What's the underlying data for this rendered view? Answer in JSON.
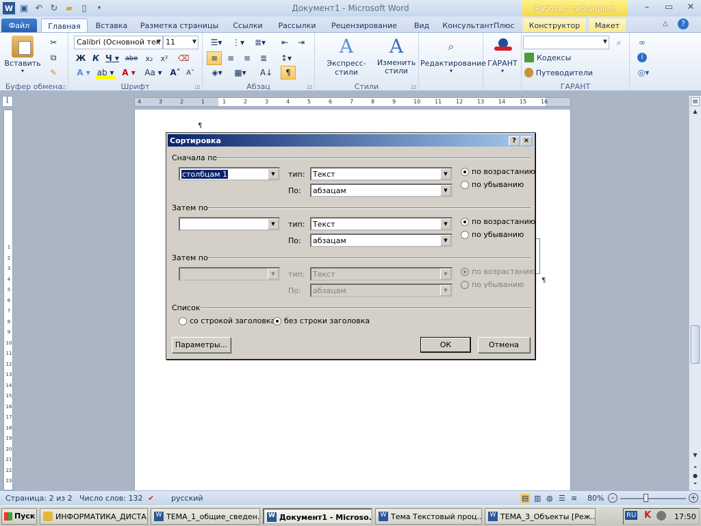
{
  "window": {
    "title": "Документ1 - Microsoft Word",
    "context_tab_header": "Работа с таблицами"
  },
  "tabs": [
    "Файл",
    "Главная",
    "Вставка",
    "Разметка страницы",
    "Ссылки",
    "Рассылки",
    "Рецензирование",
    "Вид",
    "КонсультантПлюс",
    "Конструктор",
    "Макет"
  ],
  "ribbon": {
    "clipboard": {
      "label": "Буфер обмена",
      "paste": "Вставить"
    },
    "font": {
      "label": "Шрифт",
      "font_name": "Calibri (Основной тек",
      "font_size": "11"
    },
    "paragraph": {
      "label": "Абзац"
    },
    "styles": {
      "label": "Стили",
      "express": "Экспресс-стили",
      "change": "Изменить стили"
    },
    "editing": {
      "label": "Редактирование"
    },
    "garant_btn": {
      "label": "ГАРАНТ"
    },
    "garant": {
      "label": "ГАРАНТ",
      "codecs": "Кодексы",
      "guides": "Путеводители"
    }
  },
  "ruler": {
    "h_ticks": [
      "4",
      "3",
      "2",
      "1",
      "1",
      "2",
      "3",
      "4",
      "5",
      "6",
      "7",
      "8",
      "9",
      "10",
      "11",
      "12",
      "13",
      "14",
      "15",
      "16"
    ],
    "v_ticks": [
      "1",
      "2",
      "3",
      "4",
      "5",
      "6",
      "7",
      "8",
      "9",
      "10",
      "11",
      "12",
      "13",
      "14",
      "15",
      "16",
      "17",
      "18",
      "19",
      "20",
      "21",
      "22",
      "23"
    ]
  },
  "document": {
    "pilcrow": "¶"
  },
  "dialog": {
    "title": "Сортировка",
    "help": "?",
    "close": "×",
    "first": {
      "heading": "Сначала по",
      "field": "столбцам 1",
      "type_label": "тип:",
      "type_value": "Текст",
      "by_label": "По:",
      "by_value": "абзацам",
      "asc": "по возрастанию",
      "desc": "по убыванию"
    },
    "second": {
      "heading": "Затем по",
      "field": "",
      "type_label": "тип:",
      "type_value": "Текст",
      "by_label": "По:",
      "by_value": "абзацам",
      "asc": "по возрастанию",
      "desc": "по убыванию"
    },
    "third": {
      "heading": "Затем по",
      "field": "",
      "type_label": "тип:",
      "type_value": "Текст",
      "by_label": "По:",
      "by_value": "абзацам",
      "asc": "по возрастанию",
      "desc": "по убыванию"
    },
    "list": {
      "heading": "Список",
      "with_header": "со строкой заголовка",
      "without_header": "без строки заголовка"
    },
    "buttons": {
      "options": "Параметры...",
      "ok": "ОК",
      "cancel": "Отмена"
    }
  },
  "statusbar": {
    "page": "Страница: 2 из 2",
    "words": "Число слов: 132",
    "language": "русский",
    "zoom": "80%"
  },
  "taskbar": {
    "start": "Пуск",
    "tasks": [
      "ИНФОРМАТИКА_ДИСТА...",
      "ТЕМА_1_общие_сведен...",
      "Документ1 - Microso...",
      "Тема  Текстовый проц...",
      "ТЕМА_3_Объекты [Реж..."
    ],
    "lang": "RU",
    "clock": "17:50"
  },
  "colors": {
    "title_gradient_start": "#0a246a",
    "file_tab": "#2a5fb0",
    "context_tab": "#f5d849"
  }
}
